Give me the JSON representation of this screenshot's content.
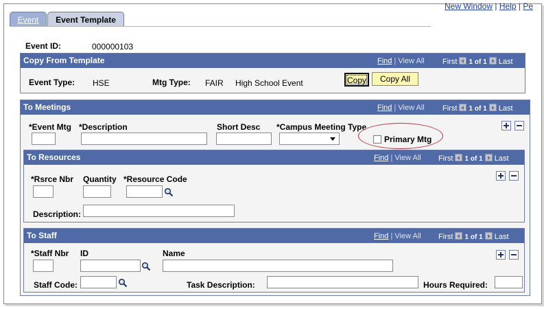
{
  "top_links": {
    "new_window": "New Window",
    "help": "Help",
    "sep": "|",
    "partial": "Pe"
  },
  "tabs": [
    {
      "label": "Event",
      "active": false
    },
    {
      "label": "Event Template",
      "active": true
    }
  ],
  "event": {
    "id_label": "Event ID:",
    "id_value": "000000103"
  },
  "nav": {
    "find": "Find",
    "sep": "|",
    "view_all": "View All",
    "first": "First",
    "of": "1 of 1",
    "last": "Last"
  },
  "copy_from_template": {
    "title": "Copy From Template",
    "event_type_label": "Event Type:",
    "event_type_value": "HSE",
    "mtg_type_label": "Mtg Type:",
    "mtg_type_value": "FAIR",
    "mtg_type_desc": "High School Event",
    "copy_label": "Copy",
    "copy_all_label": "Copy All"
  },
  "to_meetings": {
    "title": "To Meetings",
    "event_mtg_label": "*Event Mtg",
    "description_label": "*Description",
    "short_desc_label": "Short Desc",
    "campus_meeting_type_label": "*Campus Meeting Type",
    "primary_mtg_label": "Primary Mtg"
  },
  "to_resources": {
    "title": "To Resources",
    "rsrce_nbr_label": "*Rsrce Nbr",
    "quantity_label": "Quantity",
    "resource_code_label": "*Resource Code",
    "description_label": "Description:"
  },
  "to_staff": {
    "title": "To Staff",
    "staff_nbr_label": "*Staff Nbr",
    "id_label": "ID",
    "name_label": "Name",
    "staff_code_label": "Staff Code:",
    "task_description_label": "Task Description:",
    "hours_required_label": "Hours Required:"
  },
  "colors": {
    "header_bg": "#4f6aa7",
    "button_bg": "#fbf7b0",
    "highlight": "#c0303a"
  },
  "icons": [
    "plus-icon",
    "minus-icon",
    "lookup-icon",
    "prev-arrow-icon",
    "next-arrow-icon",
    "dropdown-arrow-icon"
  ]
}
